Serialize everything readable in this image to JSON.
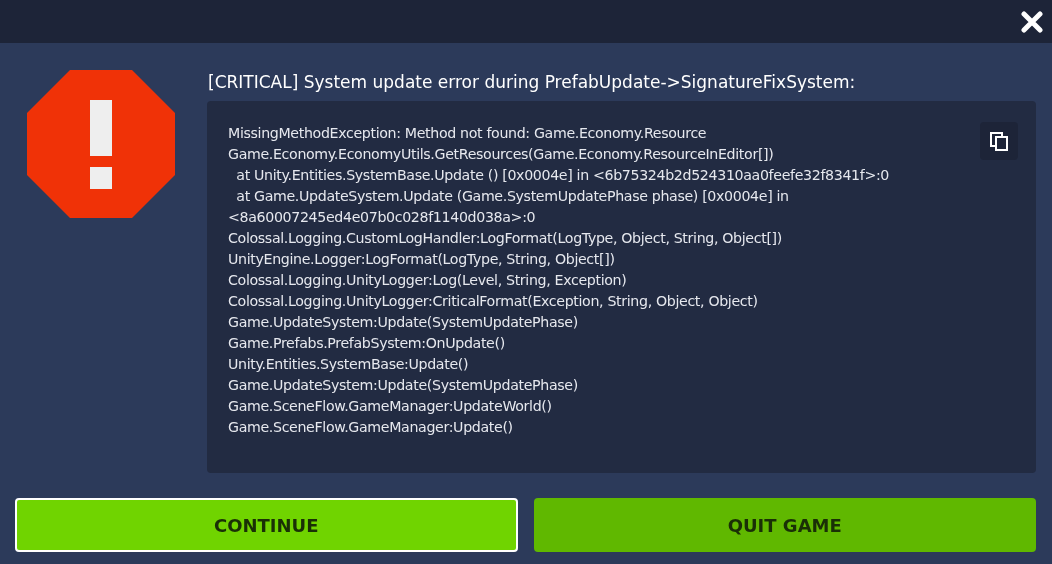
{
  "title": "[CRITICAL] System update error during PrefabUpdate->SignatureFixSystem:",
  "log_lines": [
    "MissingMethodException: Method not found: Game.Economy.Resource",
    "Game.Economy.EconomyUtils.GetResources(Game.Economy.ResourceInEditor[])",
    "  at Unity.Entities.SystemBase.Update () [0x0004e] in <6b75324b2d524310aa0feefe32f8341f>:0",
    "  at Game.UpdateSystem.Update (Game.SystemUpdatePhase phase) [0x0004e] in",
    "<8a60007245ed4e07b0c028f1140d038a>:0",
    "Colossal.Logging.CustomLogHandler:LogFormat(LogType, Object, String, Object[])",
    "UnityEngine.Logger:LogFormat(LogType, String, Object[])",
    "Colossal.Logging.UnityLogger:Log(Level, String, Exception)",
    "Colossal.Logging.UnityLogger:CriticalFormat(Exception, String, Object, Object)",
    "Game.UpdateSystem:Update(SystemUpdatePhase)",
    "Game.Prefabs.PrefabSystem:OnUpdate()",
    "Unity.Entities.SystemBase:Update()",
    "Game.UpdateSystem:Update(SystemUpdatePhase)",
    "Game.SceneFlow.GameManager:UpdateWorld()",
    "Game.SceneFlow.GameManager:Update()"
  ],
  "buttons": [
    {
      "label": "CONTINUE",
      "selected": true
    },
    {
      "label": "QUIT GAME",
      "selected": false
    }
  ]
}
